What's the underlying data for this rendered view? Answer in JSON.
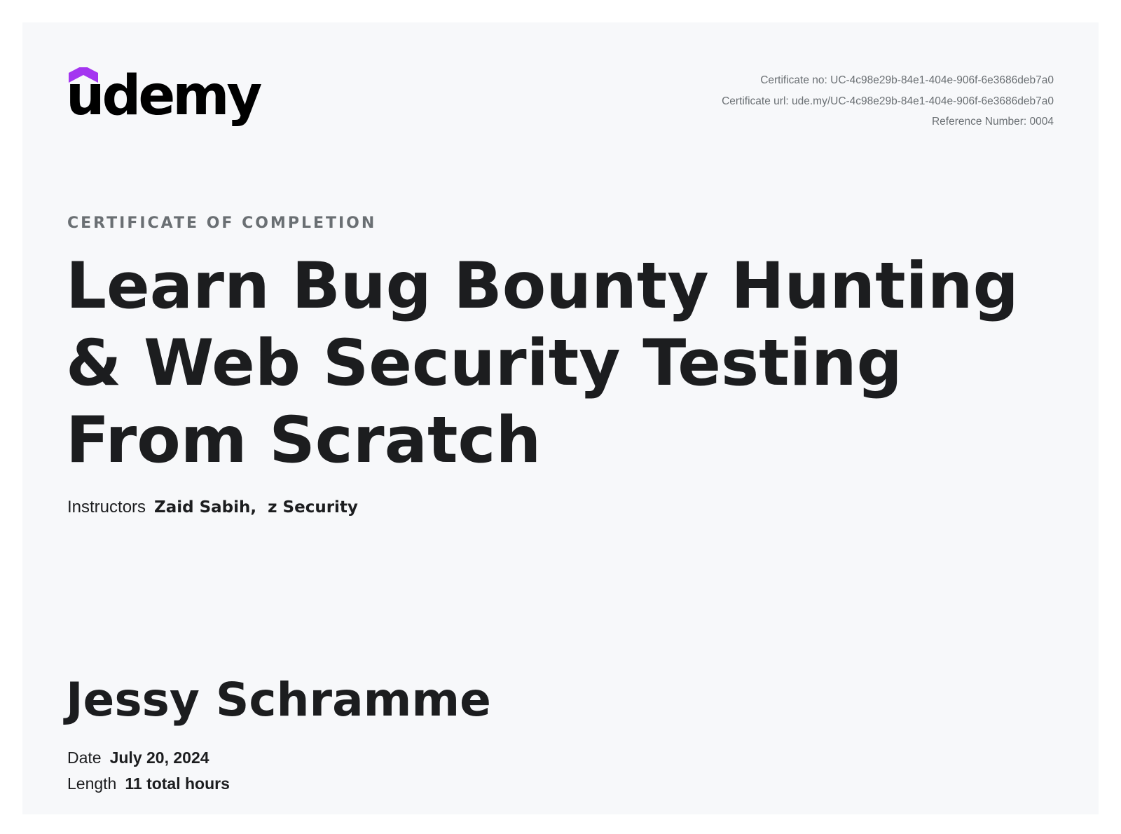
{
  "brand": {
    "logo_text": "udemy",
    "accent": "#a435f0"
  },
  "meta": {
    "certificate_no": "Certificate no: UC-4c98e29b-84e1-404e-906f-6e3686deb7a0",
    "certificate_url": "Certificate url: ude.my/UC-4c98e29b-84e1-404e-906f-6e3686deb7a0",
    "reference_number": "Reference Number: 0004"
  },
  "eyebrow": "CERTIFICATE OF COMPLETION",
  "course_title": "Learn Bug Bounty Hunting & Web Security Testing From Scratch",
  "instructors": {
    "label": "Instructors",
    "names": "Zaid Sabih,  z Security"
  },
  "recipient": "Jessy Schramme",
  "date": {
    "label": "Date",
    "value": "July 20, 2024"
  },
  "length": {
    "label": "Length",
    "value": "11 total hours"
  }
}
